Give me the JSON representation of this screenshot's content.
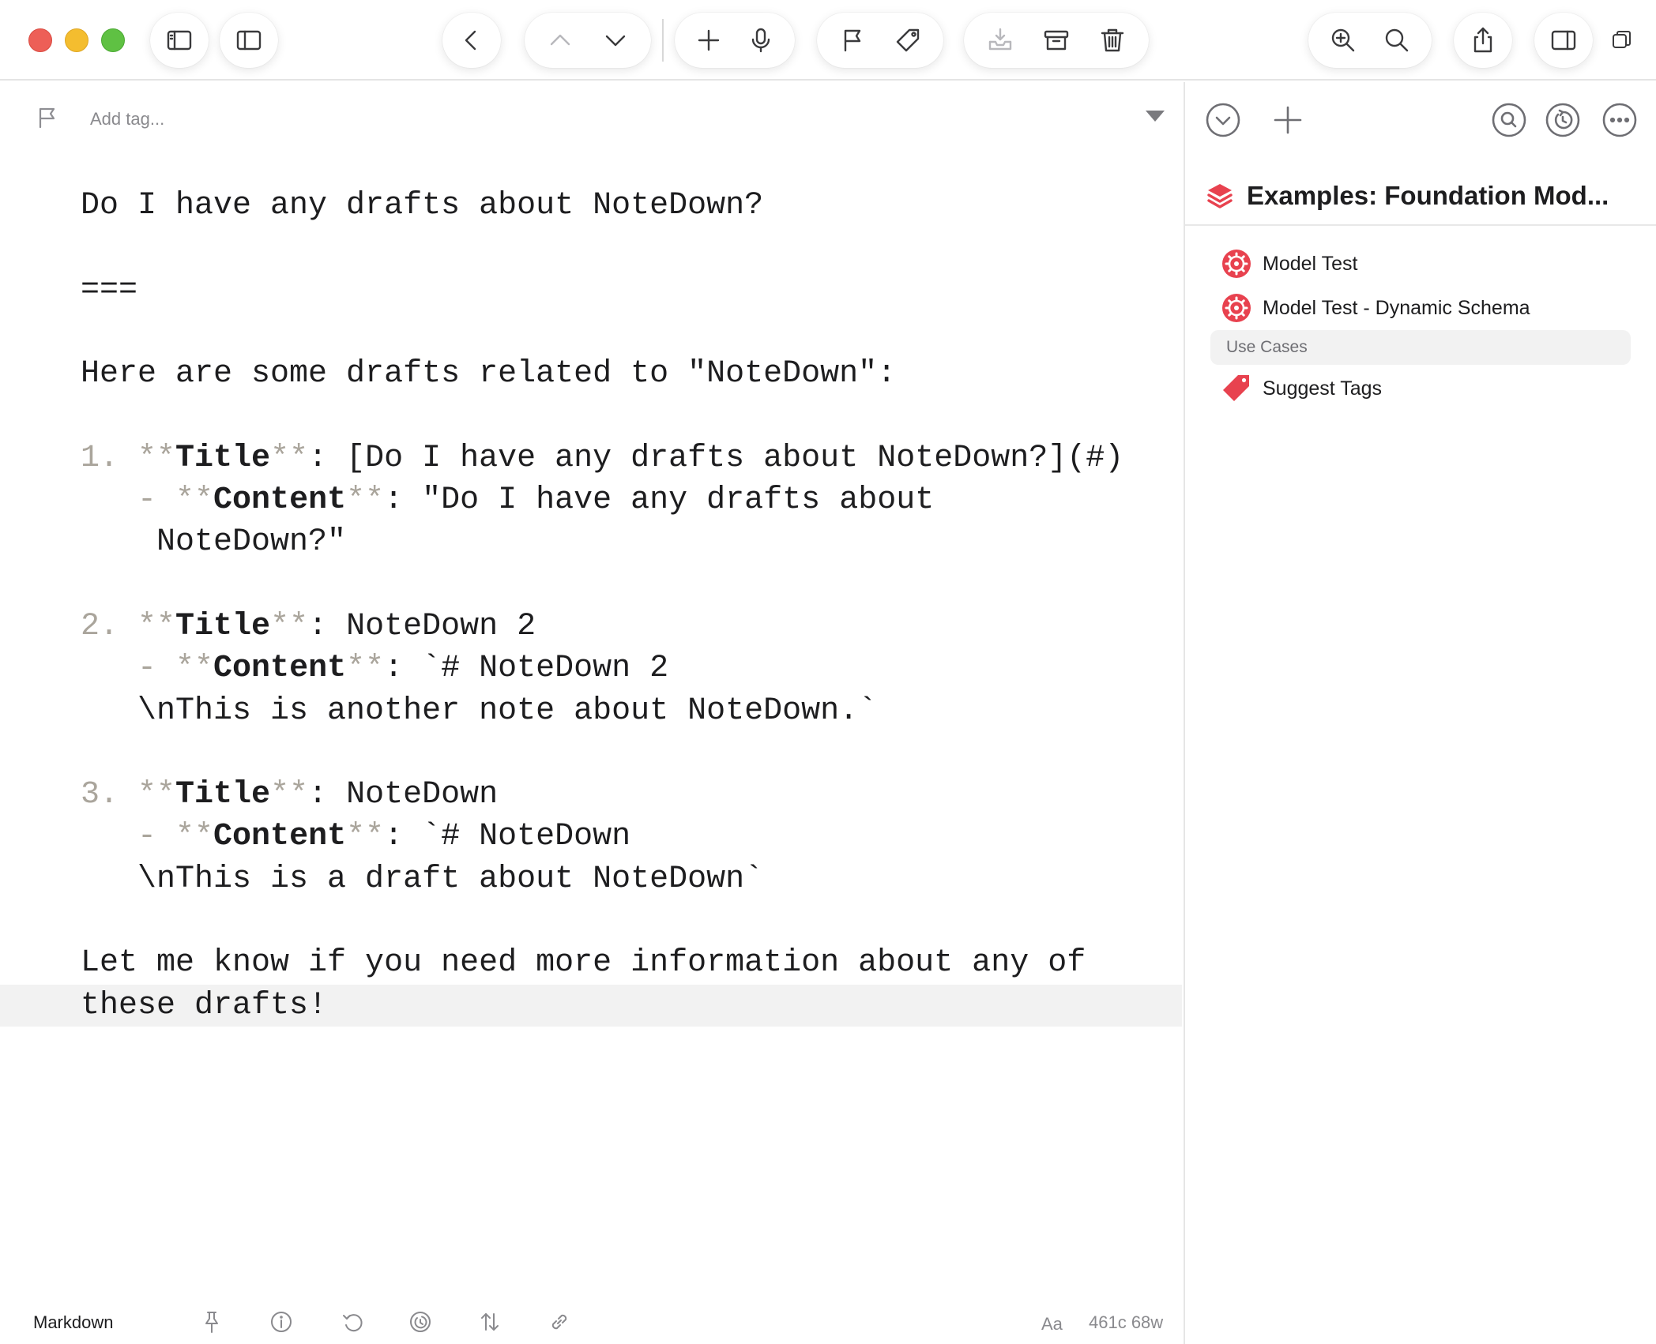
{
  "toolbar": {
    "buttons": [
      "toggle-drafts-list",
      "toggle-sidebar",
      "back",
      "previous-draft",
      "next-draft",
      "new-draft",
      "dictate",
      "flag",
      "tag",
      "move-to-inbox",
      "archive",
      "trash",
      "zoom-in",
      "search",
      "share",
      "toggle-action-panel",
      "window-mode"
    ]
  },
  "editor": {
    "tag_placeholder": "Add tag...",
    "lines": [
      {
        "text": "Do I have any drafts about NoteDown?"
      },
      {
        "text": ""
      },
      {
        "text": "==="
      },
      {
        "text": ""
      },
      {
        "text": "Here are some drafts related to \"NoteDown\":"
      },
      {
        "text": ""
      },
      {
        "num": "1. ",
        "label": "Title",
        "rest": ": [Do I have any drafts about NoteDown?](#)"
      },
      {
        "indent": "   ",
        "dash": "- ",
        "label": "Content",
        "rest": ": \"Do I have any drafts about"
      },
      {
        "text": "    NoteDown?\""
      },
      {
        "text": ""
      },
      {
        "num": "2. ",
        "label": "Title",
        "rest": ": NoteDown 2"
      },
      {
        "indent": "   ",
        "dash": "- ",
        "label": "Content",
        "rest": ": `# NoteDown 2"
      },
      {
        "text": "   \\nThis is another note about NoteDown.`"
      },
      {
        "text": ""
      },
      {
        "num": "3. ",
        "label": "Title",
        "rest": ": NoteDown"
      },
      {
        "indent": "   ",
        "dash": "- ",
        "label": "Content",
        "rest": ": `# NoteDown"
      },
      {
        "text": "   \\nThis is a draft about NoteDown`"
      },
      {
        "text": ""
      },
      {
        "text": "Let me know if you need more information about any of"
      },
      {
        "text": "these drafts!",
        "current": true
      }
    ]
  },
  "footer": {
    "mode": "Markdown",
    "font_label": "Aa",
    "count": "461c 68w"
  },
  "sidebar": {
    "group_title": "Examples: Foundation Mod...",
    "actions": [
      {
        "label": "Model Test",
        "icon": "gear-icon"
      },
      {
        "label": "Model Test - Dynamic Schema",
        "icon": "gear-icon"
      }
    ],
    "section": "Use Cases",
    "section_actions": [
      {
        "label": "Suggest Tags",
        "icon": "tag-icon"
      }
    ]
  },
  "colors": {
    "accent_red": "#e8424f",
    "markdown_marker": "#aaa59c",
    "current_line": "#f2f2f2"
  }
}
